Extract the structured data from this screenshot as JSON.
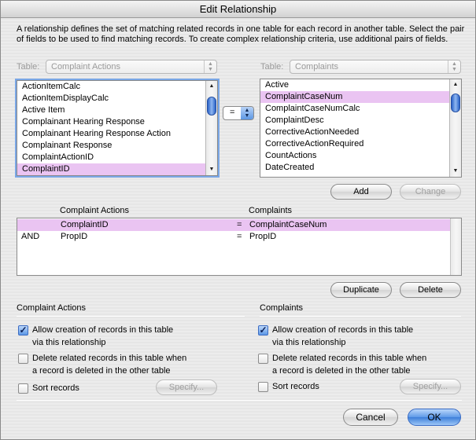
{
  "window": {
    "title": "Edit Relationship"
  },
  "description": "A relationship defines the set of matching related records in one table for each record in another table. Select the pair of fields to be used to find matching records. To create complex relationship criteria, use additional pairs of fields.",
  "left_table": {
    "label": "Table:",
    "value": "Complaint Actions",
    "fields": [
      "ActionItemCalc",
      "ActionItemDisplayCalc",
      "Active Item",
      "Complainant Hearing Response",
      "Complainant Hearing Response Action",
      "Complainant Response",
      "ComplaintActionID",
      "ComplaintID"
    ],
    "selected_index": 7
  },
  "right_table": {
    "label": "Table:",
    "value": "Complaints",
    "fields": [
      "Active",
      "ComplaintCaseNum",
      "ComplaintCaseNumCalc",
      "ComplaintDesc",
      "CorrectiveActionNeeded",
      "CorrectiveActionRequired",
      "CountActions",
      "DateCreated"
    ],
    "selected_index": 1
  },
  "operator": {
    "value": "="
  },
  "buttons": {
    "add": "Add",
    "change": "Change",
    "duplicate": "Duplicate",
    "delete": "Delete",
    "cancel": "Cancel",
    "ok": "OK",
    "specify_left": "Specify...",
    "specify_right": "Specify..."
  },
  "criteria": {
    "header_left": "Complaint Actions",
    "header_right": "Complaints",
    "rows": [
      {
        "conj": "",
        "left": "ComplaintID",
        "op": "=",
        "right": "ComplaintCaseNum",
        "selected": true
      },
      {
        "conj": "AND",
        "left": "PropID",
        "op": "=",
        "right": "PropID",
        "selected": false
      }
    ]
  },
  "left_options": {
    "title": "Complaint Actions",
    "allow_creation_line1": "Allow creation of records in this table",
    "allow_creation_line2": "via this relationship",
    "allow_creation_checked": true,
    "delete_related_line1": "Delete related records in this table when",
    "delete_related_line2": "a record is deleted in the other table",
    "delete_related_checked": false,
    "sort_records": "Sort records",
    "sort_records_checked": false
  },
  "right_options": {
    "title": "Complaints",
    "allow_creation_line1": "Allow creation of records in this table",
    "allow_creation_line2": "via this relationship",
    "allow_creation_checked": true,
    "delete_related_line1": "Delete related records in this table when",
    "delete_related_line2": "a record is deleted in the other table",
    "delete_related_checked": false,
    "sort_records": "Sort records",
    "sort_records_checked": false
  },
  "colors": {
    "selection": "#eac4f2",
    "accent": "#5d98e6"
  },
  "icons": {
    "checkmark": "checkmark-icon",
    "scroll_up": "scroll-up-arrow-icon",
    "scroll_down": "scroll-down-arrow-icon",
    "popup_arrows": "updown-arrows-icon"
  }
}
